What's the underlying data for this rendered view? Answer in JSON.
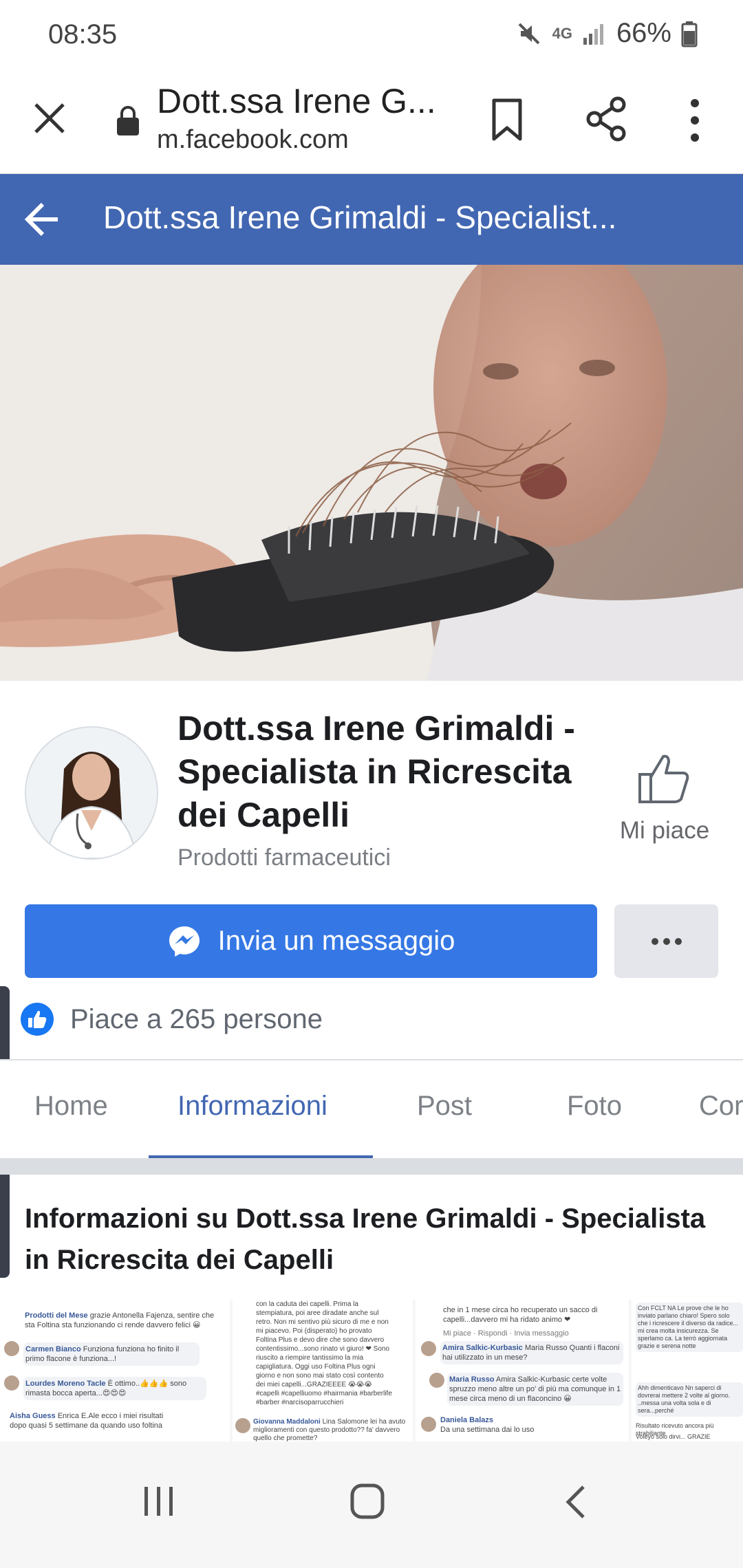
{
  "status_bar": {
    "time": "08:35",
    "network": "4G",
    "battery": "66%"
  },
  "browser": {
    "title": "Dott.ssa Irene G...",
    "url": "m.facebook.com"
  },
  "fb_header": {
    "title": "Dott.ssa Irene Grimaldi - Specialist..."
  },
  "profile": {
    "name": "Dott.ssa Irene Grimaldi - Specialista in Ricrescita dei Capelli",
    "category": "Prodotti farmaceutici",
    "like_label": "Mi piace"
  },
  "actions": {
    "message_button": "Invia un messaggio"
  },
  "likes": {
    "text": "Piace a 265 persone"
  },
  "tabs": [
    {
      "label": "Home"
    },
    {
      "label": "Informazioni"
    },
    {
      "label": "Post"
    },
    {
      "label": "Foto"
    },
    {
      "label": "Cor"
    }
  ],
  "active_tab": "Informazioni",
  "info": {
    "title": "Informazioni su Dott.ssa Irene Grimaldi - Specialista in Ricrescita dei Capelli"
  },
  "collage": {
    "c1_n1": "Prodotti del Mese",
    "c1_t1": "grazie Antonella Fajenza, sentire che sta Foltina sta funzionando ci rende davvero felici 😀",
    "c1_n2": "Carmen Bianco",
    "c1_t2": "Funziona funziona ho finito il primo flacone è funziona...!",
    "c1_n3": "Lourdes Moreno Tacle",
    "c1_t3": "È ottimo..👍👍👍 sono rimasta bocca aperta...😍😍😍",
    "c1_n4": "Aisha Guess",
    "c1_t4": "Enrica E.Ale ecco i miei risultati dopo quasi 5 settimane da quando uso foltina",
    "c2_t1": "con la caduta dei capelli. Prima la stempiatura, poi aree diradate anche sul retro. Non mi sentivo più sicuro di me e non mi piacevo. Poi (disperato) ho provato Foltina Plus e devo dire che sono davvero contentissimo...sono rinato vi giuro! ❤ Sono riuscito a riempire tantissimo la mia capigliatura. Oggi uso Foltina Plus ogni giorno e non sono mai stato così contento dei miei capelli...GRAZIEEEE 😭😭😭 #capelli #capelliuomo #hairmania #barberlife #barber #narcisoparrucchieri",
    "c2_n2": "Giovanna Maddaloni",
    "c2_t2": "Lina Salomone lei ha avuto miglioramenti con questo prodotto?? fa' davvero quello che promette?",
    "c3_t1": "che in 1 mese circa ho recuperato un sacco di capelli...davvero mi ha ridato animo ❤",
    "c3_n2": "Amira Salkic-Kurbasic",
    "c3_t2": "Maria Russo Quanti i flaconi hai utilizzato in un mese?",
    "c3_n3": "Maria Russo",
    "c3_t3": "Amira Salkic-Kurbasic certe volte spruzzo meno altre un po' di più ma comunque in 1 mese circa meno di un flaconcino 😀",
    "c3_n4": "Daniela Balazs",
    "c3_t4": "Da una settimana dai lo uso",
    "c4_t1": "Con FCLT NA Le prove che le ho inviato parlano chiaro! Spero solo che i ricrescere il diverso da radice... mi crea molta insicurezza. Se sperlamo ca. La terrò aggiornata grazie e serena notte",
    "c4_t2": "Ahh dimenticavo Nn saperci di dovrerai mettere 2 volte al giorno. ..messa una volta sola e di sera...perché",
    "c4_t3": "Risultato ricevuto ancora più strabiliante",
    "c4_t4": "Voleyo solo dirvi... GRAZIE",
    "meta_like": "Mi piace · Rispondi · Invia messaggio"
  }
}
